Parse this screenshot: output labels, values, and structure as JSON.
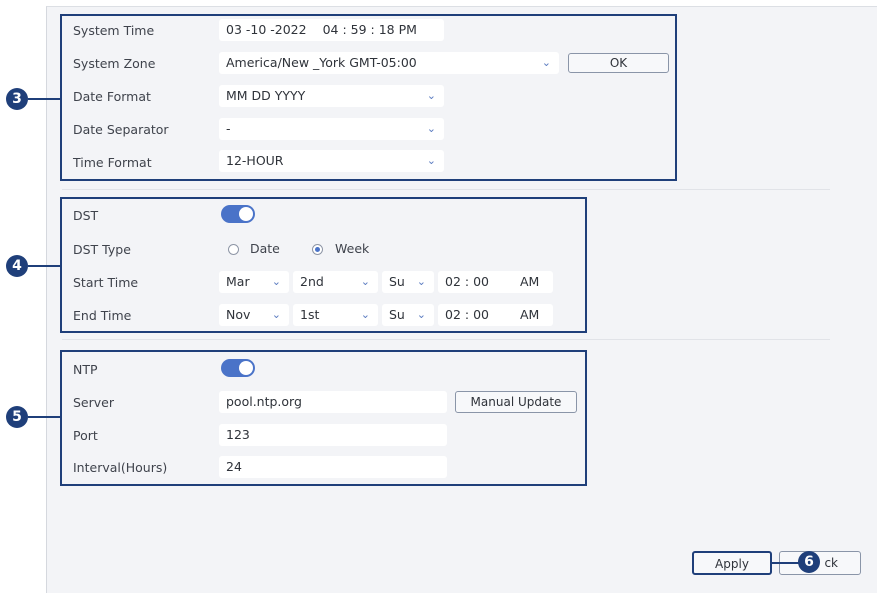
{
  "time_section": {
    "system_time_label": "System Time",
    "system_time_date": "03 -10 -2022",
    "system_time_clock": "04 : 59 : 18  PM",
    "system_zone_label": "System Zone",
    "system_zone_value": "America/New _York GMT-05:00",
    "ok_label": "OK",
    "date_format_label": "Date Format",
    "date_format_value": "MM DD YYYY",
    "date_separator_label": "Date Separator",
    "date_separator_value": "-",
    "time_format_label": "Time Format",
    "time_format_value": "12-HOUR"
  },
  "dst_section": {
    "dst_label": "DST",
    "dst_enabled": true,
    "dst_type_label": "DST Type",
    "type_options": [
      "Date",
      "Week"
    ],
    "type_selected": "Week",
    "start_time_label": "Start Time",
    "start": {
      "month": "Mar",
      "week": "2nd",
      "day": "Su",
      "time": "02 : 00",
      "ampm": "AM"
    },
    "end_time_label": "End Time",
    "end": {
      "month": "Nov",
      "week": "1st",
      "day": "Su",
      "time": "02 : 00",
      "ampm": "AM"
    }
  },
  "ntp_section": {
    "ntp_label": "NTP",
    "ntp_enabled": true,
    "server_label": "Server",
    "server_value": "pool.ntp.org",
    "manual_update_label": "Manual Update",
    "port_label": "Port",
    "port_value": "123",
    "interval_label": "Interval(Hours)",
    "interval_value": "24"
  },
  "footer": {
    "apply_label": "Apply",
    "back_label_visible": "ck"
  },
  "callouts": {
    "c3": "3",
    "c4": "4",
    "c5": "5",
    "c6": "6"
  },
  "colors": {
    "accent": "#1f3f7a",
    "toggle_on": "#4a73c8",
    "panel_bg": "#f3f4f7"
  }
}
